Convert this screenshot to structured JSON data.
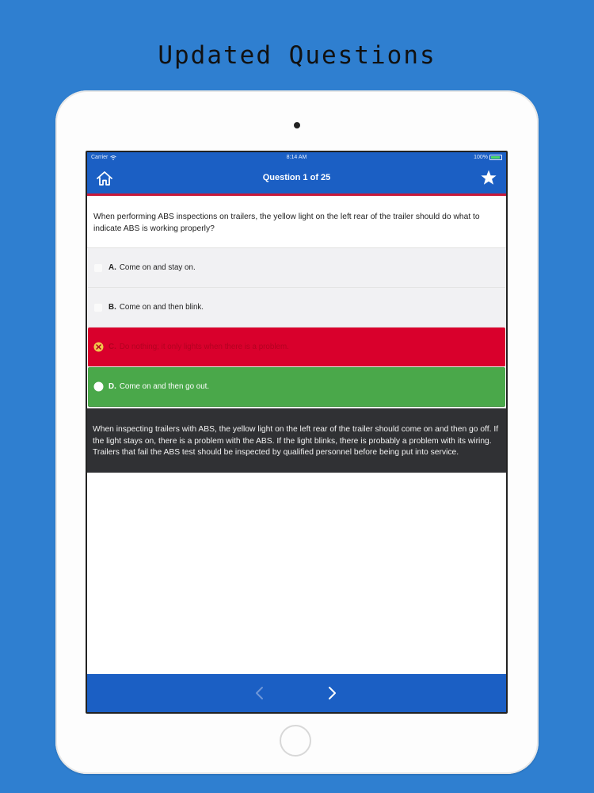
{
  "promo": {
    "title": "Updated Questions"
  },
  "status_bar": {
    "carrier": "Carrier",
    "time": "8:14 AM",
    "battery": "100%"
  },
  "nav": {
    "title": "Question 1 of 25",
    "home_icon": "home-icon",
    "star_icon": "star-icon"
  },
  "question": {
    "text": "When performing ABS inspections on trailers, the yellow light on the left rear of the trailer should do what to indicate ABS is working properly?"
  },
  "answers": [
    {
      "letter": "A.",
      "text": "Come on and stay on.",
      "state": "neutral"
    },
    {
      "letter": "B.",
      "text": "Come on and then blink.",
      "state": "neutral"
    },
    {
      "letter": "C.",
      "text": "Do nothing; it only lights when there is a problem.",
      "state": "wrong"
    },
    {
      "letter": "D.",
      "text": "Come on and then go out.",
      "state": "correct"
    }
  ],
  "explanation": {
    "text": "When inspecting trailers with ABS, the yellow light on the left rear of the trailer should come on and then go off. If the light stays on, there is a problem with the ABS. If the light blinks, there is probably a problem with its wiring. Trailers that fail the ABS test should be inspected by qualified personnel before being put into service."
  },
  "colors": {
    "background": "#2f7fd0",
    "nav": "#1b5fc4",
    "accent_red": "#c8193a",
    "wrong": "#d9002c",
    "correct": "#4aa84a",
    "explanation_bg": "#303134"
  },
  "bottom_nav": {
    "prev_icon": "chevron-left-icon",
    "next_icon": "chevron-right-icon"
  }
}
